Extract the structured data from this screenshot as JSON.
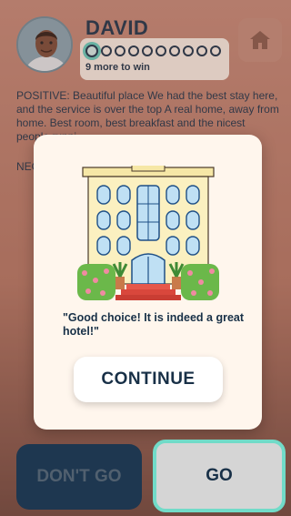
{
  "player": {
    "name": "DAVID"
  },
  "progress": {
    "total_dots": 10,
    "current_dot": 1,
    "remaining_text": "9 more to win"
  },
  "review": {
    "positive_label": "POSITIVE:",
    "positive_text": " Beautiful place We had the best stay here, and the service is over the top A real home, away from home. Best room, best breakfast and the nicest people runni",
    "negative_label": "NEG"
  },
  "modal": {
    "message": "\"Good choice! It is indeed a great hotel!\"",
    "continue_label": "CONTINUE"
  },
  "actions": {
    "dont_go_label": "DON'T GO",
    "go_label": "GO"
  },
  "icons": {
    "home": "home-icon",
    "avatar": "avatar-portrait",
    "hotel": "hotel-illustration"
  },
  "colors": {
    "text_navy": "#183047",
    "accent_teal": "#71dbc8",
    "modal_bg": "#fff6ed",
    "dont_go_bg": "#1e3750",
    "go_bg": "#d5d5d5"
  }
}
